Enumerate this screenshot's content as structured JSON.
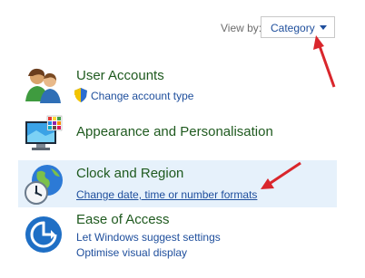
{
  "view_by": {
    "label": "View by:",
    "selected": "Category"
  },
  "categories": [
    {
      "title": "User Accounts",
      "icon": "users-icon",
      "links": [
        {
          "text": "Change account type",
          "shield": true
        }
      ]
    },
    {
      "title": "Appearance and Personalisation",
      "icon": "monitor-palette-icon",
      "links": []
    },
    {
      "title": "Clock and Region",
      "icon": "clock-globe-icon",
      "links": [
        {
          "text": "Change date, time or number formats"
        }
      ]
    },
    {
      "title": "Ease of Access",
      "icon": "ease-of-access-icon",
      "links": [
        {
          "text": "Let Windows suggest settings"
        },
        {
          "text": "Optimise visual display"
        }
      ]
    }
  ],
  "colors": {
    "title_green": "#1f5a1f",
    "link_blue": "#1e4e9c",
    "highlight_bg": "#e6f1fb",
    "annotation_red": "#d9262c"
  }
}
